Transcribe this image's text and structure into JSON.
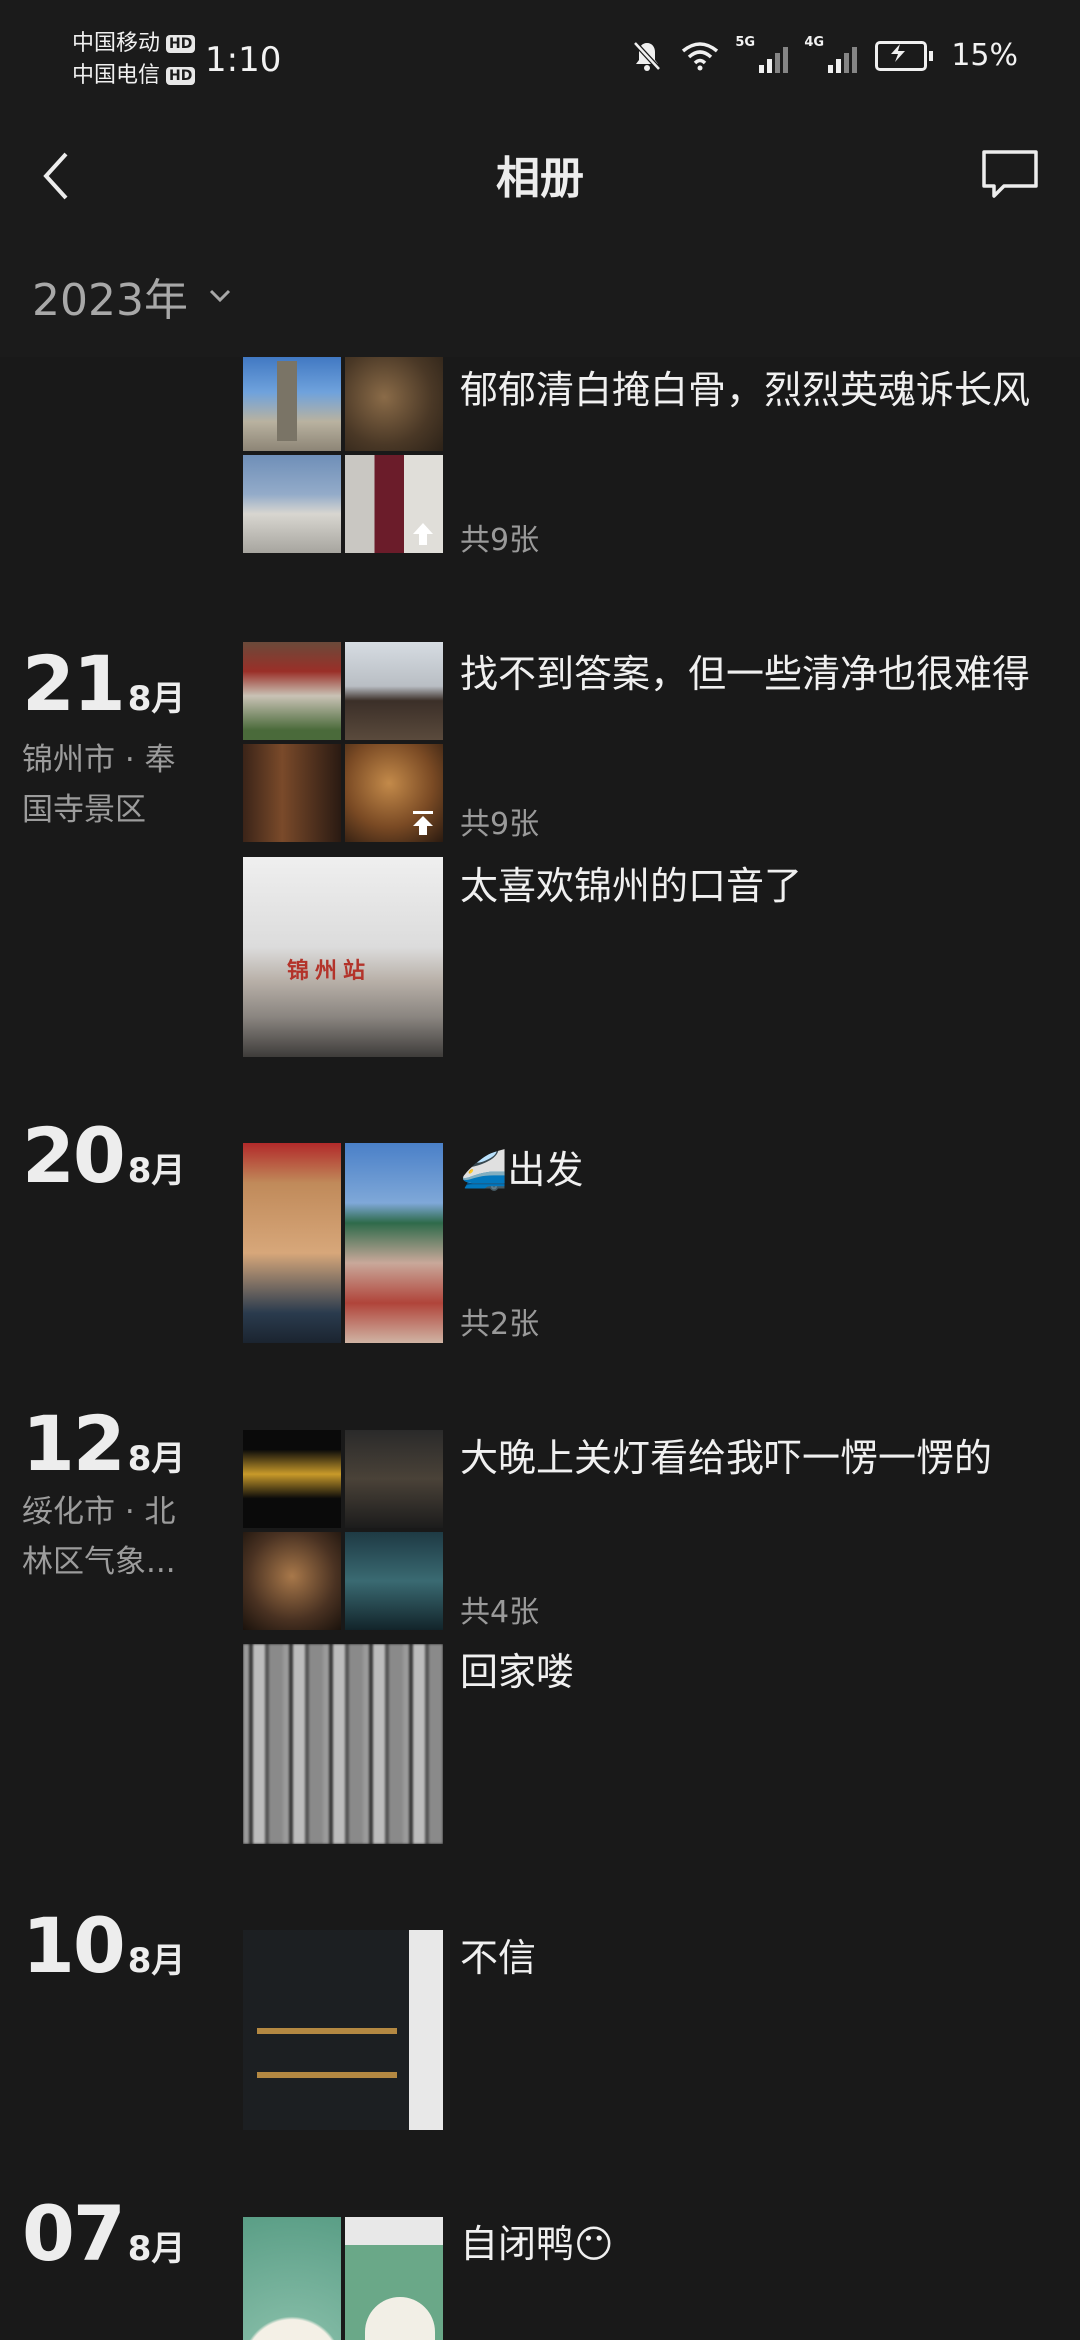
{
  "status_bar": {
    "carrier1": "中国移动",
    "carrier2": "中国电信",
    "hd_badge": "HD",
    "time": "1:10",
    "net5g": "5G",
    "net4g": "4G",
    "battery": "15%"
  },
  "header": {
    "title": "相册"
  },
  "year_selector": {
    "label": "2023年"
  },
  "entries": [
    {
      "caption": "郁郁清白掩白骨，烈烈英魂诉长风",
      "count": "共9张"
    },
    {
      "day": "21",
      "month": "8月",
      "location": "锦州市 · 奉国寺景区",
      "caption": "找不到答案，但一些清净也很难得",
      "count": "共9张"
    },
    {
      "caption": "太喜欢锦州的口音了"
    },
    {
      "day": "20",
      "month": "8月",
      "caption": "🚄出发",
      "count": "共2张"
    },
    {
      "day": "12",
      "month": "8月",
      "location": "绥化市 · 北林区气象...",
      "caption": "大晚上关灯看给我吓一愣一愣的",
      "count": "共4张"
    },
    {
      "caption": "回家喽"
    },
    {
      "day": "10",
      "month": "8月",
      "caption": "不信"
    },
    {
      "day": "07",
      "month": "8月",
      "caption": "自闭鸭😶"
    }
  ]
}
